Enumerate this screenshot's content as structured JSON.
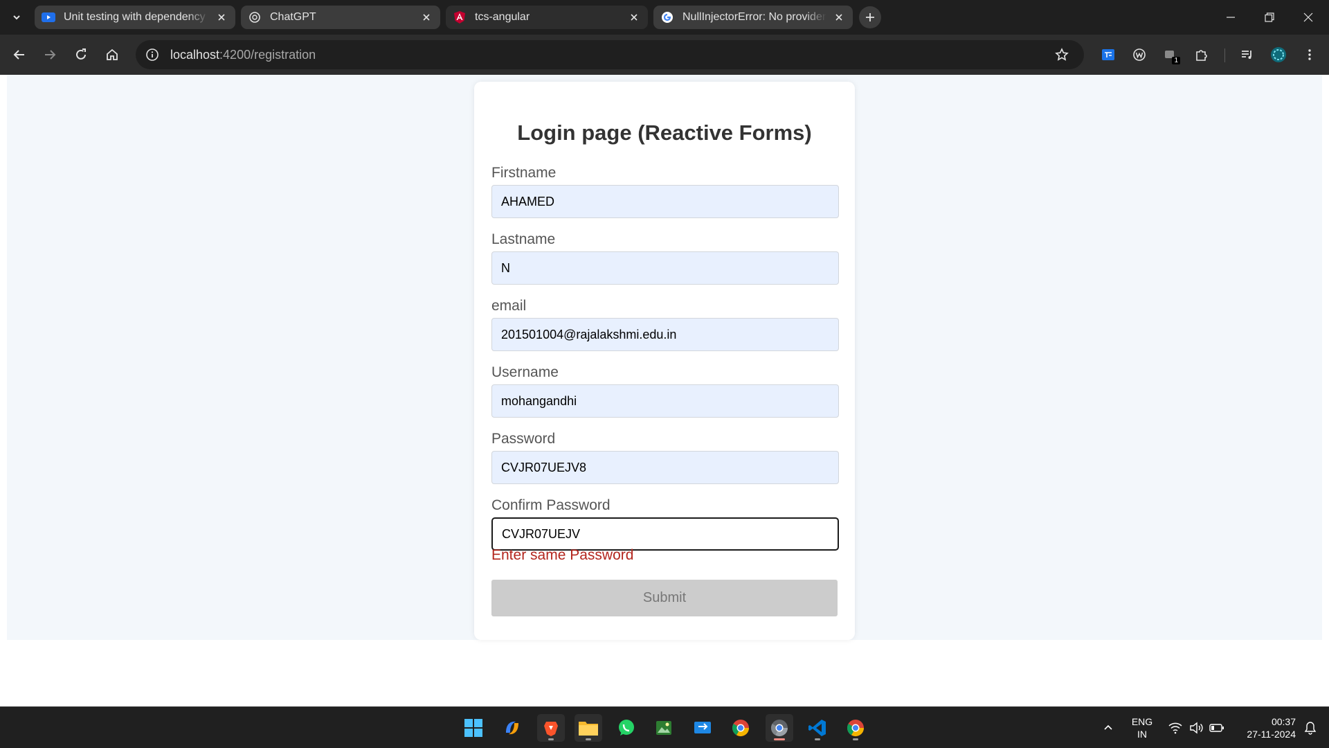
{
  "browser": {
    "tabs": [
      {
        "title": "Unit testing with dependency ir",
        "icon": "youtube-icon",
        "active": false
      },
      {
        "title": "ChatGPT",
        "icon": "chatgpt-icon",
        "active": false
      },
      {
        "title": "tcs-angular",
        "icon": "angular-icon",
        "active": true
      },
      {
        "title": "NullInjectorError: No provider fo",
        "icon": "google-icon",
        "active": false
      }
    ],
    "address": {
      "host": "localhost",
      "path": ":4200/registration"
    },
    "extension_badge": "1"
  },
  "form": {
    "title": "Login page (Reactive Forms)",
    "fields": [
      {
        "label": "Firstname",
        "value": "AHAMED"
      },
      {
        "label": "Lastname",
        "value": "N"
      },
      {
        "label": "email",
        "value": "201501004@rajalakshmi.edu.in"
      },
      {
        "label": "Username",
        "value": "mohangandhi"
      },
      {
        "label": "Password",
        "value": "CVJR07UEJV8"
      },
      {
        "label": "Confirm Password",
        "value": "CVJR07UEJV"
      }
    ],
    "error": "Enter same Password",
    "submit_label": "Submit"
  },
  "taskbar": {
    "apps": [
      "start-icon",
      "copilot-icon",
      "brave-icon",
      "file-explorer-icon",
      "whatsapp-icon",
      "photos-icon",
      "remote-desktop-icon",
      "chrome-icon",
      "chrome-dev-icon",
      "vscode-icon",
      "chrome-canary-icon"
    ],
    "language": "ENG",
    "region": "IN",
    "time": "00:37",
    "date": "27-11-2024"
  },
  "colors": {
    "accent_error": "#b3261e",
    "autofill_bg": "#e8f0fe",
    "submit_disabled_bg": "#cccccc"
  }
}
